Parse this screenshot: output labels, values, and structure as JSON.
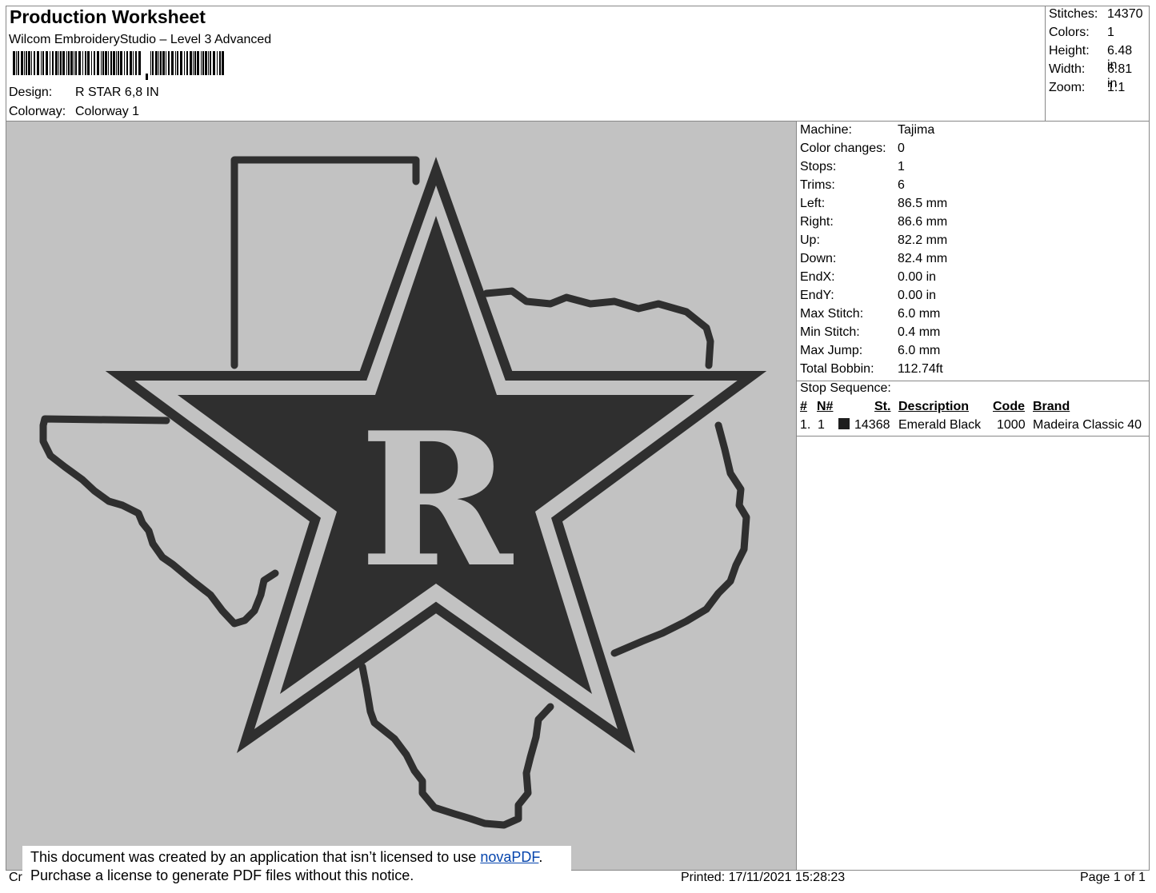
{
  "header": {
    "title": "Production Worksheet",
    "software": "Wilcom EmbroideryStudio – Level 3 Advanced",
    "design_label": "Design:",
    "design_value": "R STAR 6,8 IN",
    "colorway_label": "Colorway:",
    "colorway_value": "Colorway 1"
  },
  "stats": [
    {
      "label": "Stitches:",
      "value": "14370"
    },
    {
      "label": "Colors:",
      "value": "1"
    },
    {
      "label": "Height:",
      "value": "6.48 in"
    },
    {
      "label": "Width:",
      "value": "6.81 in"
    },
    {
      "label": "Zoom:",
      "value": "1:1"
    }
  ],
  "machine_info": [
    {
      "label": "Machine:",
      "value": "Tajima"
    },
    {
      "label": "Color changes:",
      "value": "0"
    },
    {
      "label": "Stops:",
      "value": "1"
    },
    {
      "label": "Trims:",
      "value": "6"
    },
    {
      "label": "Left:",
      "value": "86.5 mm"
    },
    {
      "label": "Right:",
      "value": "86.6 mm"
    },
    {
      "label": "Up:",
      "value": "82.2 mm"
    },
    {
      "label": "Down:",
      "value": "82.4 mm"
    },
    {
      "label": "EndX:",
      "value": "0.00 in"
    },
    {
      "label": "EndY:",
      "value": "0.00 in"
    },
    {
      "label": "Max Stitch:",
      "value": "6.0 mm"
    },
    {
      "label": "Min Stitch:",
      "value": "0.4 mm"
    },
    {
      "label": "Max Jump:",
      "value": "6.0 mm"
    },
    {
      "label": "Total Bobbin:",
      "value": "112.74ft"
    }
  ],
  "stop_sequence": {
    "title": "Stop Sequence:",
    "headers": {
      "idx": "#",
      "needle": "N#",
      "stitches": "St.",
      "description": "Description",
      "code": "Code",
      "brand": "Brand"
    },
    "rows": [
      {
        "idx": "1.",
        "needle": "1",
        "swatch_color": "#1e1e1e",
        "stitches": "14368",
        "description": "Emerald Black",
        "code": "1000",
        "brand": "Madeira Classic 40"
      }
    ]
  },
  "design_art": {
    "letter": "R",
    "thread_color": "#2f2f2f",
    "fabric_color": "#c2c2c2"
  },
  "notice": {
    "line1_prefix": "This document was created by an application that isn’t licensed to use ",
    "link": "novaPDF",
    "line1_suffix": ".",
    "line2": "Purchase a license to generate PDF files without this notice."
  },
  "footer": {
    "left_fragment": "Cr",
    "printed": "Printed: 17/11/2021 15:28:23",
    "page": "Page 1 of 1"
  }
}
